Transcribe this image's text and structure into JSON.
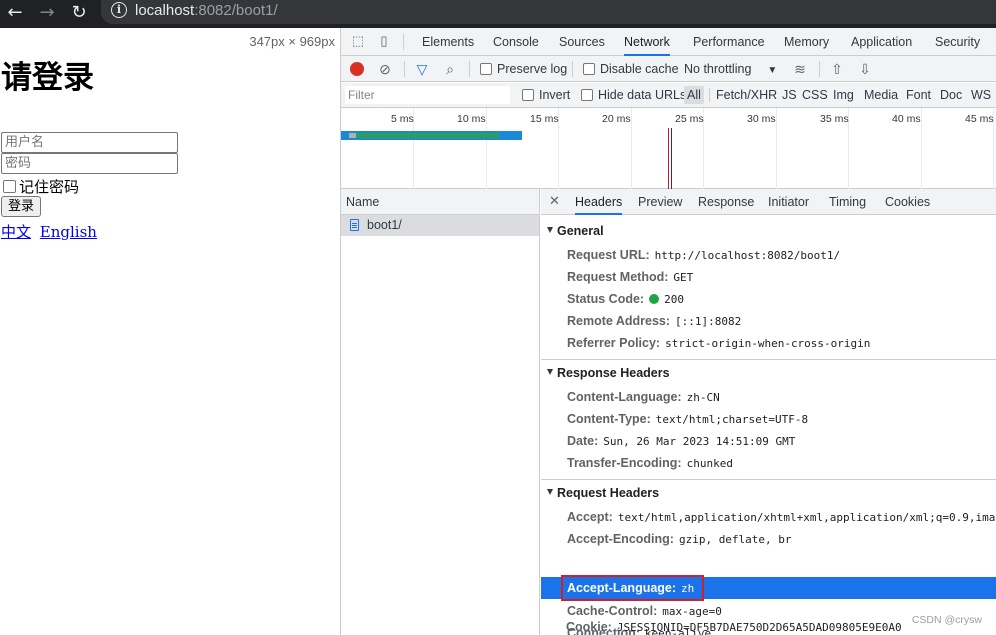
{
  "browser": {
    "url_host": "localhost",
    "url_rest": ":8082/boot1/"
  },
  "page": {
    "viewport_size": "347px × 969px",
    "title": "请登录",
    "username_placeholder": "用户名",
    "password_placeholder": "密码",
    "remember_label": "记住密码",
    "login_button": "登录",
    "lang_zh": "中文",
    "lang_en": "English"
  },
  "devtools": {
    "tabs": [
      "Elements",
      "Console",
      "Sources",
      "Network",
      "Performance",
      "Memory",
      "Application",
      "Security"
    ],
    "active_tab": "Network",
    "toolbar": {
      "preserve_log": "Preserve log",
      "disable_cache": "Disable cache",
      "throttling": "No throttling"
    },
    "filter_bar": {
      "placeholder": "Filter",
      "invert": "Invert",
      "hide_data_urls": "Hide data URLs",
      "types": [
        "All",
        "Fetch/XHR",
        "JS",
        "CSS",
        "Img",
        "Media",
        "Font",
        "Doc",
        "WS"
      ]
    },
    "timeline_ticks": [
      "5 ms",
      "10 ms",
      "15 ms",
      "20 ms",
      "25 ms",
      "30 ms",
      "35 ms",
      "40 ms",
      "45 ms"
    ],
    "name_column": "Name",
    "requests": [
      "boot1/"
    ],
    "detail_tabs": [
      "Headers",
      "Preview",
      "Response",
      "Initiator",
      "Timing",
      "Cookies"
    ],
    "general": {
      "title": "General",
      "rows": [
        {
          "key": "Request URL:",
          "value": "http://localhost:8082/boot1/"
        },
        {
          "key": "Request Method:",
          "value": "GET"
        },
        {
          "key": "Status Code:",
          "value": "200"
        },
        {
          "key": "Remote Address:",
          "value": "[::1]:8082"
        },
        {
          "key": "Referrer Policy:",
          "value": "strict-origin-when-cross-origin"
        }
      ]
    },
    "response_headers": {
      "title": "Response Headers",
      "rows": [
        {
          "key": "Content-Language:",
          "value": "zh-CN"
        },
        {
          "key": "Content-Type:",
          "value": "text/html;charset=UTF-8"
        },
        {
          "key": "Date:",
          "value": "Sun, 26 Mar 2023 14:51:09 GMT"
        },
        {
          "key": "Transfer-Encoding:",
          "value": "chunked"
        }
      ]
    },
    "request_headers": {
      "title": "Request Headers",
      "rows": [
        {
          "key": "Accept:",
          "value": "text/html,application/xhtml+xml,application/xml;q=0.9,imag"
        },
        {
          "key": "Accept-Encoding:",
          "value": "gzip, deflate, br"
        },
        {
          "key": "Accept-Language:",
          "value": "zh"
        },
        {
          "key": "Cache-Control:",
          "value": "max-age=0"
        },
        {
          "key": "Connection:",
          "value": "keep-alive"
        },
        {
          "key": "Cookie:",
          "value": "JSESSIONID=DF5B7DAE750D2D65A5DAD09805E9E0A0"
        }
      ]
    },
    "watermark": "CSDN @crysw"
  },
  "colors": {
    "accent": "#1a73e8",
    "record": "#d93025",
    "status_ok": "#1ea446",
    "highlight_box": "#d0202a"
  }
}
